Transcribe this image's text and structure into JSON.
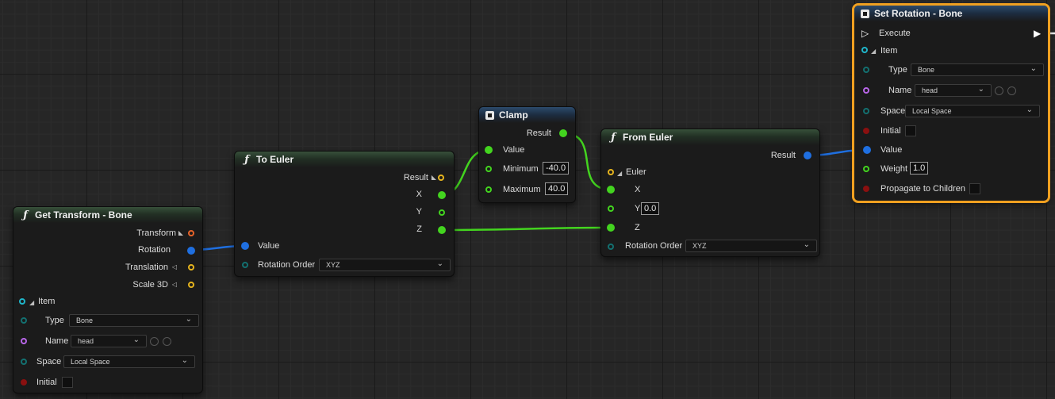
{
  "nodes": {
    "get_transform": {
      "title": "Get Transform - Bone",
      "outputs": [
        "Transform",
        "Rotation",
        "Translation",
        "Scale 3D"
      ],
      "item_label": "Item",
      "type_label": "Type",
      "type_value": "Bone",
      "name_label": "Name",
      "name_value": "head",
      "space_label": "Space",
      "space_value": "Local Space",
      "initial_label": "Initial"
    },
    "to_euler": {
      "title": "To Euler",
      "outputs": [
        "Result",
        "X",
        "Y",
        "Z"
      ],
      "input_value": "Value",
      "rotation_order_label": "Rotation Order",
      "rotation_order_value": "XYZ"
    },
    "clamp": {
      "title": "Clamp",
      "result_label": "Result",
      "value_label": "Value",
      "minimum_label": "Minimum",
      "minimum_value": "-40.0",
      "maximum_label": "Maximum",
      "maximum_value": "40.0"
    },
    "from_euler": {
      "title": "From Euler",
      "result_label": "Result",
      "euler_label": "Euler",
      "x_label": "X",
      "y_label": "Y",
      "y_value": "0.0",
      "z_label": "Z",
      "rotation_order_label": "Rotation Order",
      "rotation_order_value": "XYZ"
    },
    "set_rotation": {
      "title": "Set Rotation - Bone",
      "execute_label": "Execute",
      "item_label": "Item",
      "type_label": "Type",
      "type_value": "Bone",
      "name_label": "Name",
      "name_value": "head",
      "space_label": "Space",
      "space_value": "Local Space",
      "initial_label": "Initial",
      "value_label": "Value",
      "weight_label": "Weight",
      "weight_value": "1.0",
      "propagate_label": "Propagate to Children"
    }
  },
  "colors": {
    "float_pin": "#43d41f",
    "rotation_pin": "#1f6fe0",
    "transform_pin": "#e8642a",
    "vector_pin": "#e6b41e",
    "item_pin": "#1fb5c9",
    "name_pin": "#b866e8",
    "bool_pin": "#8a1010",
    "enum_pin": "#137070",
    "selection": "#f0a020"
  }
}
